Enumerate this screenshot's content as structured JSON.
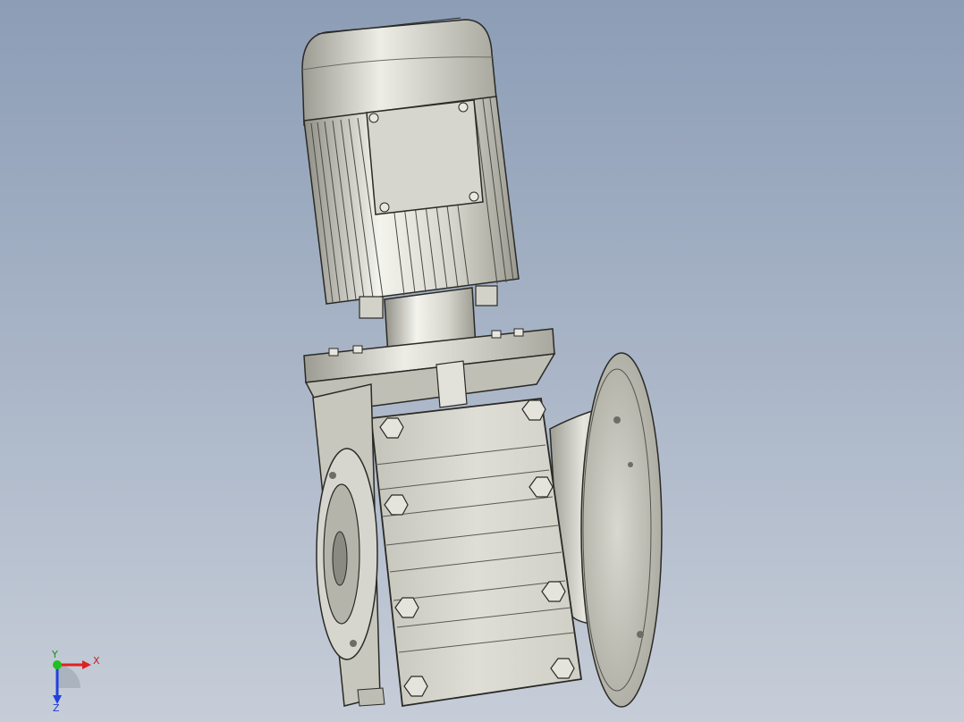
{
  "viewport": {
    "background_top": "#8c9db6",
    "background_bottom": "#c6cdd8"
  },
  "model": {
    "part_colors": {
      "metal_light": "#ebebe4",
      "metal_mid": "#c9c9c0",
      "metal_dark": "#8f8f86",
      "outline": "#2a2a26"
    }
  },
  "triad": {
    "x_label": "X",
    "y_label": "Y",
    "z_label": "Z",
    "x_color": "#e02020",
    "y_color": "#20c020",
    "z_color": "#2040e0"
  }
}
